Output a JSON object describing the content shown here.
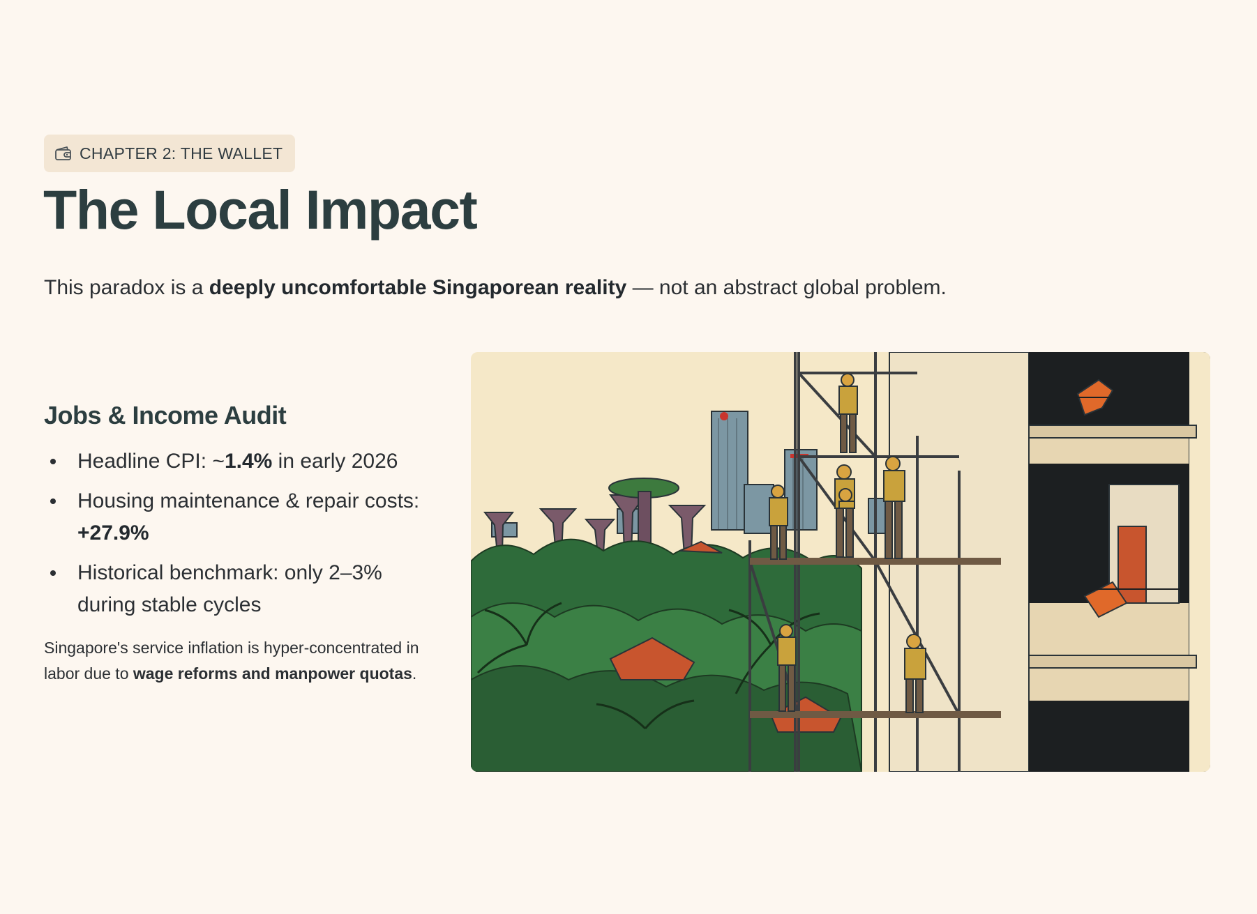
{
  "badge": {
    "icon": "wallet-icon",
    "label": "CHAPTER 2: THE WALLET"
  },
  "title": "The Local Impact",
  "lede": {
    "before": "This paradox is a ",
    "bold": "deeply uncomfortable Singaporean reality",
    "after": " — not an abstract global problem."
  },
  "audit": {
    "heading": "Jobs & Income Audit",
    "items": [
      {
        "pre": "Headline CPI: ~",
        "bold": "1.4%",
        "post": " in early 2026"
      },
      {
        "pre": "Housing maintenance & repair costs: ",
        "bold": "+27.9%",
        "post": ""
      },
      {
        "pre": "Historical benchmark: only 2–3% during stable cycles",
        "bold": "",
        "post": ""
      }
    ],
    "note": {
      "pre": "Singapore's service inflation is hyper-concentrated in labor due to ",
      "bold": "wage reforms and manpower quotas",
      "post": "."
    }
  },
  "illustration": {
    "description_icon": "city-workers-illustration",
    "colors": {
      "sky": "#f5e8c8",
      "foliage": "#2e6b3a",
      "roof": "#c8552e",
      "building": "#efe3c7",
      "worker": "#c9a23c"
    }
  }
}
